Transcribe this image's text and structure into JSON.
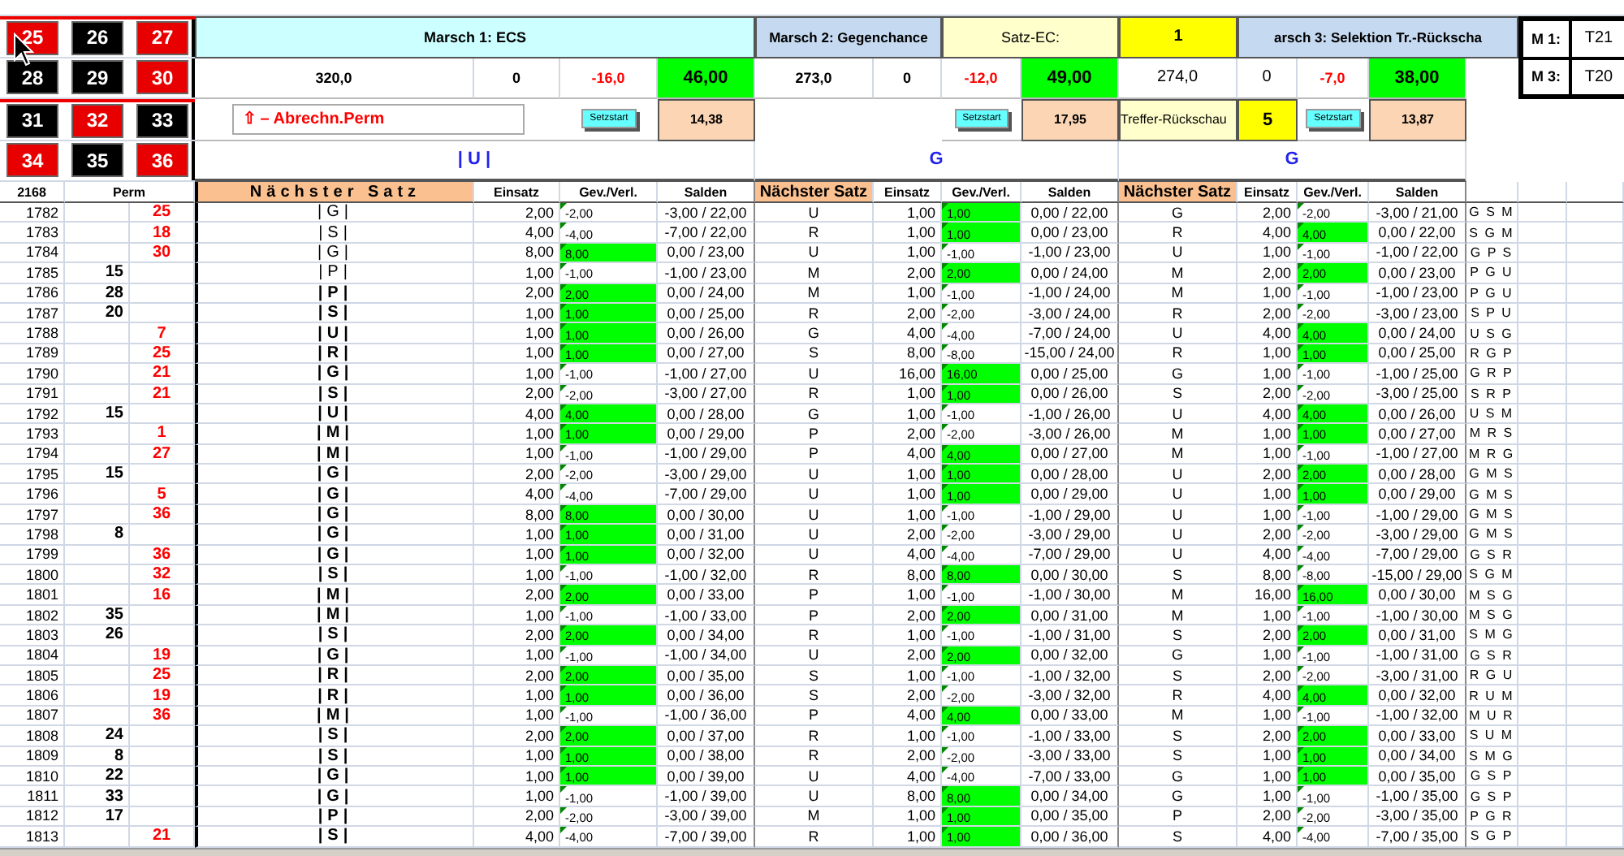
{
  "roulette": [
    {
      "number": "25",
      "kind": "red"
    },
    {
      "number": "26",
      "kind": "black"
    },
    {
      "number": "27",
      "kind": "red"
    },
    {
      "number": "28",
      "kind": "black"
    },
    {
      "number": "29",
      "kind": "black"
    },
    {
      "number": "30",
      "kind": "red"
    },
    {
      "number": "31",
      "kind": "black"
    },
    {
      "number": "32",
      "kind": "red"
    },
    {
      "number": "33",
      "kind": "black"
    },
    {
      "number": "34",
      "kind": "red"
    },
    {
      "number": "35",
      "kind": "black"
    },
    {
      "number": "36",
      "kind": "red"
    }
  ],
  "marsch": [
    {
      "title": "Marsch 1: ECS",
      "total": "320,0",
      "count": "0",
      "diff": "-16,0",
      "balance": "46,00",
      "button": "Setzstart",
      "ratio": "14,38",
      "next": "| U |"
    },
    {
      "title": "Marsch 2: Gegenchance",
      "total": "273,0",
      "count": "0",
      "diff": "-12,0",
      "balance": "49,00",
      "button": "Setzstart",
      "ratio": "17,95",
      "next": "G"
    },
    {
      "title": "arsch 3: Selektion Tr.-Rückscha",
      "total": "274,0",
      "count": "0",
      "diff": "-7,0",
      "balance": "38,00",
      "button": "Setzstart",
      "ratio": "13,87",
      "next": "G"
    }
  ],
  "abrechnung": "⇧ – Abrechn.Perm",
  "satz_ec": {
    "label": "Satz-EC:",
    "value": "1"
  },
  "treffer": {
    "label": "Treffer-Rückschau",
    "value": "5"
  },
  "m_box": [
    {
      "label": "M 1:",
      "value": "T21"
    },
    {
      "label": "M 3:",
      "value": "T20"
    }
  ],
  "table": {
    "header": {
      "nr": "2168",
      "perm": "Perm",
      "blocks": [
        {
          "satz": "Nächster Satz",
          "einsatz": "Einsatz",
          "gv": "Gev./Verl.",
          "saldo": "Salden"
        },
        {
          "satz": "Nächster Satz",
          "einsatz": "Einsatz",
          "gv": "Gev./Verl.",
          "saldo": "Salden"
        },
        {
          "satz": "Nächster Satz",
          "einsatz": "Einsatz",
          "gv": "Gev./Verl.",
          "saldo": "Salden"
        }
      ]
    },
    "rows": [
      {
        "nr": "1782",
        "perm": {
          "number": "25",
          "kind": "red"
        },
        "m1": {
          "satz": "|G|",
          "bold": false,
          "einsatz": "2,00",
          "gv": "-2,00",
          "won": false,
          "saldo": "-3,00 / 22,00"
        },
        "m2": {
          "satz": "U",
          "einsatz": "1,00",
          "gv": "1,00",
          "won": true,
          "saldo": "0,00 / 22,00"
        },
        "m3": {
          "satz": "G",
          "einsatz": "2,00",
          "gv": "-2,00",
          "won": false,
          "saldo": "-3,00 / 21,00"
        },
        "pattern": "G S M"
      },
      {
        "nr": "1783",
        "perm": {
          "number": "18",
          "kind": "red"
        },
        "m1": {
          "satz": "|S|",
          "bold": false,
          "einsatz": "4,00",
          "gv": "-4,00",
          "won": false,
          "saldo": "-7,00 / 22,00"
        },
        "m2": {
          "satz": "R",
          "einsatz": "1,00",
          "gv": "1,00",
          "won": true,
          "saldo": "0,00 / 23,00"
        },
        "m3": {
          "satz": "R",
          "einsatz": "4,00",
          "gv": "4,00",
          "won": true,
          "saldo": "0,00 / 22,00"
        },
        "pattern": "S G M"
      },
      {
        "nr": "1784",
        "perm": {
          "number": "30",
          "kind": "red"
        },
        "m1": {
          "satz": "|G|",
          "bold": false,
          "einsatz": "8,00",
          "gv": "8,00",
          "won": true,
          "saldo": "0,00 / 23,00"
        },
        "m2": {
          "satz": "U",
          "einsatz": "1,00",
          "gv": "-1,00",
          "won": false,
          "saldo": "-1,00 / 23,00"
        },
        "m3": {
          "satz": "U",
          "einsatz": "1,00",
          "gv": "-1,00",
          "won": false,
          "saldo": "-1,00 / 22,00"
        },
        "pattern": "G P S"
      },
      {
        "nr": "1785",
        "perm": {
          "number": "15",
          "kind": "black"
        },
        "m1": {
          "satz": "|P|",
          "bold": false,
          "einsatz": "1,00",
          "gv": "-1,00",
          "won": false,
          "saldo": "-1,00 / 23,00"
        },
        "m2": {
          "satz": "M",
          "einsatz": "2,00",
          "gv": "2,00",
          "won": true,
          "saldo": "0,00 / 24,00"
        },
        "m3": {
          "satz": "M",
          "einsatz": "2,00",
          "gv": "2,00",
          "won": true,
          "saldo": "0,00 / 23,00"
        },
        "pattern": "P G U"
      },
      {
        "nr": "1786",
        "perm": {
          "number": "28",
          "kind": "black"
        },
        "m1": {
          "satz": "|P|",
          "bold": true,
          "einsatz": "2,00",
          "gv": "2,00",
          "won": true,
          "saldo": "0,00 / 24,00"
        },
        "m2": {
          "satz": "M",
          "einsatz": "1,00",
          "gv": "-1,00",
          "won": false,
          "saldo": "-1,00 / 24,00"
        },
        "m3": {
          "satz": "M",
          "einsatz": "1,00",
          "gv": "-1,00",
          "won": false,
          "saldo": "-1,00 / 23,00"
        },
        "pattern": "P G U"
      },
      {
        "nr": "1787",
        "perm": {
          "number": "20",
          "kind": "black"
        },
        "m1": {
          "satz": "|S|",
          "bold": true,
          "einsatz": "1,00",
          "gv": "1,00",
          "won": true,
          "saldo": "0,00 / 25,00"
        },
        "m2": {
          "satz": "R",
          "einsatz": "2,00",
          "gv": "-2,00",
          "won": false,
          "saldo": "-3,00 / 24,00"
        },
        "m3": {
          "satz": "R",
          "einsatz": "2,00",
          "gv": "-2,00",
          "won": false,
          "saldo": "-3,00 / 23,00"
        },
        "pattern": "S P U"
      },
      {
        "nr": "1788",
        "perm": {
          "number": "7",
          "kind": "red"
        },
        "m1": {
          "satz": "|U|",
          "bold": true,
          "einsatz": "1,00",
          "gv": "1,00",
          "won": true,
          "saldo": "0,00 / 26,00"
        },
        "m2": {
          "satz": "G",
          "einsatz": "4,00",
          "gv": "-4,00",
          "won": false,
          "saldo": "-7,00 / 24,00"
        },
        "m3": {
          "satz": "U",
          "einsatz": "4,00",
          "gv": "4,00",
          "won": true,
          "saldo": "0,00 / 24,00"
        },
        "pattern": "U S G"
      },
      {
        "nr": "1789",
        "perm": {
          "number": "25",
          "kind": "red"
        },
        "m1": {
          "satz": "|R|",
          "bold": true,
          "einsatz": "1,00",
          "gv": "1,00",
          "won": true,
          "saldo": "0,00 / 27,00"
        },
        "m2": {
          "satz": "S",
          "einsatz": "8,00",
          "gv": "-8,00",
          "won": false,
          "saldo": "-15,00 / 24,00"
        },
        "m3": {
          "satz": "R",
          "einsatz": "1,00",
          "gv": "1,00",
          "won": true,
          "saldo": "0,00 / 25,00"
        },
        "pattern": "R G P"
      },
      {
        "nr": "1790",
        "perm": {
          "number": "21",
          "kind": "red"
        },
        "m1": {
          "satz": "|G|",
          "bold": true,
          "einsatz": "1,00",
          "gv": "-1,00",
          "won": false,
          "saldo": "-1,00 / 27,00"
        },
        "m2": {
          "satz": "U",
          "einsatz": "16,00",
          "gv": "16,00",
          "won": true,
          "saldo": "0,00 / 25,00"
        },
        "m3": {
          "satz": "G",
          "einsatz": "1,00",
          "gv": "-1,00",
          "won": false,
          "saldo": "-1,00 / 25,00"
        },
        "pattern": "G R P"
      },
      {
        "nr": "1791",
        "perm": {
          "number": "21",
          "kind": "red"
        },
        "m1": {
          "satz": "|S|",
          "bold": true,
          "einsatz": "2,00",
          "gv": "-2,00",
          "won": false,
          "saldo": "-3,00 / 27,00"
        },
        "m2": {
          "satz": "R",
          "einsatz": "1,00",
          "gv": "1,00",
          "won": true,
          "saldo": "0,00 / 26,00"
        },
        "m3": {
          "satz": "S",
          "einsatz": "2,00",
          "gv": "-2,00",
          "won": false,
          "saldo": "-3,00 / 25,00"
        },
        "pattern": "S R P"
      },
      {
        "nr": "1792",
        "perm": {
          "number": "15",
          "kind": "black"
        },
        "m1": {
          "satz": "|U|",
          "bold": true,
          "einsatz": "4,00",
          "gv": "4,00",
          "won": true,
          "saldo": "0,00 / 28,00"
        },
        "m2": {
          "satz": "G",
          "einsatz": "1,00",
          "gv": "-1,00",
          "won": false,
          "saldo": "-1,00 / 26,00"
        },
        "m3": {
          "satz": "U",
          "einsatz": "4,00",
          "gv": "4,00",
          "won": true,
          "saldo": "0,00 / 26,00"
        },
        "pattern": "U S M"
      },
      {
        "nr": "1793",
        "perm": {
          "number": "1",
          "kind": "red"
        },
        "m1": {
          "satz": "|M|",
          "bold": true,
          "einsatz": "1,00",
          "gv": "1,00",
          "won": true,
          "saldo": "0,00 / 29,00"
        },
        "m2": {
          "satz": "P",
          "einsatz": "2,00",
          "gv": "-2,00",
          "won": false,
          "saldo": "-3,00 / 26,00"
        },
        "m3": {
          "satz": "M",
          "einsatz": "1,00",
          "gv": "1,00",
          "won": true,
          "saldo": "0,00 / 27,00"
        },
        "pattern": "M R S"
      },
      {
        "nr": "1794",
        "perm": {
          "number": "27",
          "kind": "red"
        },
        "m1": {
          "satz": "|M|",
          "bold": true,
          "einsatz": "1,00",
          "gv": "-1,00",
          "won": false,
          "saldo": "-1,00 / 29,00"
        },
        "m2": {
          "satz": "P",
          "einsatz": "4,00",
          "gv": "4,00",
          "won": true,
          "saldo": "0,00 / 27,00"
        },
        "m3": {
          "satz": "M",
          "einsatz": "1,00",
          "gv": "-1,00",
          "won": false,
          "saldo": "-1,00 / 27,00"
        },
        "pattern": "M R G"
      },
      {
        "nr": "1795",
        "perm": {
          "number": "15",
          "kind": "black"
        },
        "m1": {
          "satz": "|G|",
          "bold": true,
          "einsatz": "2,00",
          "gv": "-2,00",
          "won": false,
          "saldo": "-3,00 / 29,00"
        },
        "m2": {
          "satz": "U",
          "einsatz": "1,00",
          "gv": "1,00",
          "won": true,
          "saldo": "0,00 / 28,00"
        },
        "m3": {
          "satz": "U",
          "einsatz": "2,00",
          "gv": "2,00",
          "won": true,
          "saldo": "0,00 / 28,00"
        },
        "pattern": "G M S"
      },
      {
        "nr": "1796",
        "perm": {
          "number": "5",
          "kind": "red"
        },
        "m1": {
          "satz": "|G|",
          "bold": true,
          "einsatz": "4,00",
          "gv": "-4,00",
          "won": false,
          "saldo": "-7,00 / 29,00"
        },
        "m2": {
          "satz": "U",
          "einsatz": "1,00",
          "gv": "1,00",
          "won": true,
          "saldo": "0,00 / 29,00"
        },
        "m3": {
          "satz": "U",
          "einsatz": "1,00",
          "gv": "1,00",
          "won": true,
          "saldo": "0,00 / 29,00"
        },
        "pattern": "G M S"
      },
      {
        "nr": "1797",
        "perm": {
          "number": "36",
          "kind": "red"
        },
        "m1": {
          "satz": "|G|",
          "bold": true,
          "einsatz": "8,00",
          "gv": "8,00",
          "won": true,
          "saldo": "0,00 / 30,00"
        },
        "m2": {
          "satz": "U",
          "einsatz": "1,00",
          "gv": "-1,00",
          "won": false,
          "saldo": "-1,00 / 29,00"
        },
        "m3": {
          "satz": "U",
          "einsatz": "1,00",
          "gv": "-1,00",
          "won": false,
          "saldo": "-1,00 / 29,00"
        },
        "pattern": "G M S"
      },
      {
        "nr": "1798",
        "perm": {
          "number": "8",
          "kind": "black"
        },
        "m1": {
          "satz": "|G|",
          "bold": true,
          "einsatz": "1,00",
          "gv": "1,00",
          "won": true,
          "saldo": "0,00 / 31,00"
        },
        "m2": {
          "satz": "U",
          "einsatz": "2,00",
          "gv": "-2,00",
          "won": false,
          "saldo": "-3,00 / 29,00"
        },
        "m3": {
          "satz": "U",
          "einsatz": "2,00",
          "gv": "-2,00",
          "won": false,
          "saldo": "-3,00 / 29,00"
        },
        "pattern": "G M S"
      },
      {
        "nr": "1799",
        "perm": {
          "number": "36",
          "kind": "red"
        },
        "m1": {
          "satz": "|G|",
          "bold": true,
          "einsatz": "1,00",
          "gv": "1,00",
          "won": true,
          "saldo": "0,00 / 32,00"
        },
        "m2": {
          "satz": "U",
          "einsatz": "4,00",
          "gv": "-4,00",
          "won": false,
          "saldo": "-7,00 / 29,00"
        },
        "m3": {
          "satz": "U",
          "einsatz": "4,00",
          "gv": "-4,00",
          "won": false,
          "saldo": "-7,00 / 29,00"
        },
        "pattern": "G S R"
      },
      {
        "nr": "1800",
        "perm": {
          "number": "32",
          "kind": "red"
        },
        "m1": {
          "satz": "|S|",
          "bold": true,
          "einsatz": "1,00",
          "gv": "-1,00",
          "won": false,
          "saldo": "-1,00 / 32,00"
        },
        "m2": {
          "satz": "R",
          "einsatz": "8,00",
          "gv": "8,00",
          "won": true,
          "saldo": "0,00 / 30,00"
        },
        "m3": {
          "satz": "S",
          "einsatz": "8,00",
          "gv": "-8,00",
          "won": false,
          "saldo": "-15,00 / 29,00"
        },
        "pattern": "S G M"
      },
      {
        "nr": "1801",
        "perm": {
          "number": "16",
          "kind": "red"
        },
        "m1": {
          "satz": "|M|",
          "bold": true,
          "einsatz": "2,00",
          "gv": "2,00",
          "won": true,
          "saldo": "0,00 / 33,00"
        },
        "m2": {
          "satz": "P",
          "einsatz": "1,00",
          "gv": "-1,00",
          "won": false,
          "saldo": "-1,00 / 30,00"
        },
        "m3": {
          "satz": "M",
          "einsatz": "16,00",
          "gv": "16,00",
          "won": true,
          "saldo": "0,00 / 30,00"
        },
        "pattern": "M S G"
      },
      {
        "nr": "1802",
        "perm": {
          "number": "35",
          "kind": "black"
        },
        "m1": {
          "satz": "|M|",
          "bold": true,
          "einsatz": "1,00",
          "gv": "-1,00",
          "won": false,
          "saldo": "-1,00 / 33,00"
        },
        "m2": {
          "satz": "P",
          "einsatz": "2,00",
          "gv": "2,00",
          "won": true,
          "saldo": "0,00 / 31,00"
        },
        "m3": {
          "satz": "M",
          "einsatz": "1,00",
          "gv": "-1,00",
          "won": false,
          "saldo": "-1,00 / 30,00"
        },
        "pattern": "M S G"
      },
      {
        "nr": "1803",
        "perm": {
          "number": "26",
          "kind": "black"
        },
        "m1": {
          "satz": "|S|",
          "bold": true,
          "einsatz": "2,00",
          "gv": "2,00",
          "won": true,
          "saldo": "0,00 / 34,00"
        },
        "m2": {
          "satz": "R",
          "einsatz": "1,00",
          "gv": "-1,00",
          "won": false,
          "saldo": "-1,00 / 31,00"
        },
        "m3": {
          "satz": "S",
          "einsatz": "2,00",
          "gv": "2,00",
          "won": true,
          "saldo": "0,00 / 31,00"
        },
        "pattern": "S M G"
      },
      {
        "nr": "1804",
        "perm": {
          "number": "19",
          "kind": "red"
        },
        "m1": {
          "satz": "|G|",
          "bold": true,
          "einsatz": "1,00",
          "gv": "-1,00",
          "won": false,
          "saldo": "-1,00 / 34,00"
        },
        "m2": {
          "satz": "U",
          "einsatz": "2,00",
          "gv": "2,00",
          "won": true,
          "saldo": "0,00 / 32,00"
        },
        "m3": {
          "satz": "G",
          "einsatz": "1,00",
          "gv": "-1,00",
          "won": false,
          "saldo": "-1,00 / 31,00"
        },
        "pattern": "G S R"
      },
      {
        "nr": "1805",
        "perm": {
          "number": "25",
          "kind": "red"
        },
        "m1": {
          "satz": "|R|",
          "bold": true,
          "einsatz": "2,00",
          "gv": "2,00",
          "won": true,
          "saldo": "0,00 / 35,00"
        },
        "m2": {
          "satz": "S",
          "einsatz": "1,00",
          "gv": "-1,00",
          "won": false,
          "saldo": "-1,00 / 32,00"
        },
        "m3": {
          "satz": "S",
          "einsatz": "2,00",
          "gv": "-2,00",
          "won": false,
          "saldo": "-3,00 / 31,00"
        },
        "pattern": "R G U"
      },
      {
        "nr": "1806",
        "perm": {
          "number": "19",
          "kind": "red"
        },
        "m1": {
          "satz": "|R|",
          "bold": true,
          "einsatz": "1,00",
          "gv": "1,00",
          "won": true,
          "saldo": "0,00 / 36,00"
        },
        "m2": {
          "satz": "S",
          "einsatz": "2,00",
          "gv": "-2,00",
          "won": false,
          "saldo": "-3,00 / 32,00"
        },
        "m3": {
          "satz": "R",
          "einsatz": "4,00",
          "gv": "4,00",
          "won": true,
          "saldo": "0,00 / 32,00"
        },
        "pattern": "R U M"
      },
      {
        "nr": "1807",
        "perm": {
          "number": "36",
          "kind": "red"
        },
        "m1": {
          "satz": "|M|",
          "bold": true,
          "einsatz": "1,00",
          "gv": "-1,00",
          "won": false,
          "saldo": "-1,00 / 36,00"
        },
        "m2": {
          "satz": "P",
          "einsatz": "4,00",
          "gv": "4,00",
          "won": true,
          "saldo": "0,00 / 33,00"
        },
        "m3": {
          "satz": "M",
          "einsatz": "1,00",
          "gv": "-1,00",
          "won": false,
          "saldo": "-1,00 / 32,00"
        },
        "pattern": "M U R"
      },
      {
        "nr": "1808",
        "perm": {
          "number": "24",
          "kind": "black"
        },
        "m1": {
          "satz": "|S|",
          "bold": true,
          "einsatz": "2,00",
          "gv": "2,00",
          "won": true,
          "saldo": "0,00 / 37,00"
        },
        "m2": {
          "satz": "R",
          "einsatz": "1,00",
          "gv": "-1,00",
          "won": false,
          "saldo": "-1,00 / 33,00"
        },
        "m3": {
          "satz": "S",
          "einsatz": "2,00",
          "gv": "2,00",
          "won": true,
          "saldo": "0,00 / 33,00"
        },
        "pattern": "S U M"
      },
      {
        "nr": "1809",
        "perm": {
          "number": "8",
          "kind": "black"
        },
        "m1": {
          "satz": "|S|",
          "bold": true,
          "einsatz": "1,00",
          "gv": "1,00",
          "won": true,
          "saldo": "0,00 / 38,00"
        },
        "m2": {
          "satz": "R",
          "einsatz": "2,00",
          "gv": "-2,00",
          "won": false,
          "saldo": "-3,00 / 33,00"
        },
        "m3": {
          "satz": "S",
          "einsatz": "1,00",
          "gv": "1,00",
          "won": true,
          "saldo": "0,00 / 34,00"
        },
        "pattern": "S M G"
      },
      {
        "nr": "1810",
        "perm": {
          "number": "22",
          "kind": "black"
        },
        "m1": {
          "satz": "|G|",
          "bold": true,
          "einsatz": "1,00",
          "gv": "1,00",
          "won": true,
          "saldo": "0,00 / 39,00"
        },
        "m2": {
          "satz": "U",
          "einsatz": "4,00",
          "gv": "-4,00",
          "won": false,
          "saldo": "-7,00 / 33,00"
        },
        "m3": {
          "satz": "G",
          "einsatz": "1,00",
          "gv": "1,00",
          "won": true,
          "saldo": "0,00 / 35,00"
        },
        "pattern": "G S P"
      },
      {
        "nr": "1811",
        "perm": {
          "number": "33",
          "kind": "black"
        },
        "m1": {
          "satz": "|G|",
          "bold": true,
          "einsatz": "1,00",
          "gv": "-1,00",
          "won": false,
          "saldo": "-1,00 / 39,00"
        },
        "m2": {
          "satz": "U",
          "einsatz": "8,00",
          "gv": "8,00",
          "won": true,
          "saldo": "0,00 / 34,00"
        },
        "m3": {
          "satz": "G",
          "einsatz": "1,00",
          "gv": "-1,00",
          "won": false,
          "saldo": "-1,00 / 35,00"
        },
        "pattern": "G S P"
      },
      {
        "nr": "1812",
        "perm": {
          "number": "17",
          "kind": "black"
        },
        "m1": {
          "satz": "|P|",
          "bold": true,
          "einsatz": "2,00",
          "gv": "-2,00",
          "won": false,
          "saldo": "-3,00 / 39,00"
        },
        "m2": {
          "satz": "M",
          "einsatz": "1,00",
          "gv": "1,00",
          "won": true,
          "saldo": "0,00 / 35,00"
        },
        "m3": {
          "satz": "P",
          "einsatz": "2,00",
          "gv": "-2,00",
          "won": false,
          "saldo": "-3,00 / 35,00"
        },
        "pattern": "P G R"
      },
      {
        "nr": "1813",
        "perm": {
          "number": "21",
          "kind": "red"
        },
        "m1": {
          "satz": "|S|",
          "bold": true,
          "einsatz": "4,00",
          "gv": "-4,00",
          "won": false,
          "saldo": "-7,00 / 39,00"
        },
        "m2": {
          "satz": "R",
          "einsatz": "1,00",
          "gv": "1,00",
          "won": true,
          "saldo": "0,00 / 36,00"
        },
        "m3": {
          "satz": "S",
          "einsatz": "4,00",
          "gv": "-4,00",
          "won": false,
          "saldo": "-7,00 / 35,00"
        },
        "pattern": "S G P"
      }
    ]
  }
}
